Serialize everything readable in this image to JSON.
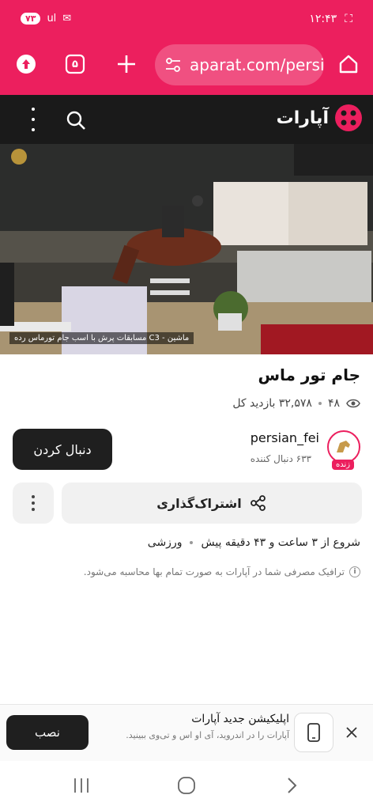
{
  "status_bar": {
    "time": "۱۲:۴۳",
    "battery": "۷۳",
    "signal_text": "ul"
  },
  "browser": {
    "url": "aparat.com/persi",
    "tab_count": "۵"
  },
  "site": {
    "logo_text": "آپارات"
  },
  "video": {
    "caption": "مسابقات پرش با اسب جام تورماس رده C3 - ماشین"
  },
  "content": {
    "title": "جام تور ماس",
    "views_count": "۴۸",
    "total_views": "۳۲,۵۷۸ بازدید کل",
    "channel_name": "persian_fei",
    "followers": "۶۳۳ دنبال کننده",
    "live_label": "زنده",
    "follow_label": "دنبال کردن",
    "share_label": "اشتراک‌گذاری",
    "start_time": "شروع از ۳ ساعت و ۴۳ دقیقه پیش",
    "category": "ورزشی",
    "traffic_notice": "ترافیک مصرفی شما در آپارات به صورت تمام بها محاسبه می‌شود."
  },
  "promo": {
    "title": "اپلیکیشن جدید آپارات",
    "subtitle": "آپارات را در اندروید، آی او اس و تی‌وی ببینید.",
    "install_label": "نصب"
  },
  "colors": {
    "brand": "#ec1f5e",
    "header_bg": "#1a1a1a",
    "button_dark": "#1f1f1f"
  }
}
